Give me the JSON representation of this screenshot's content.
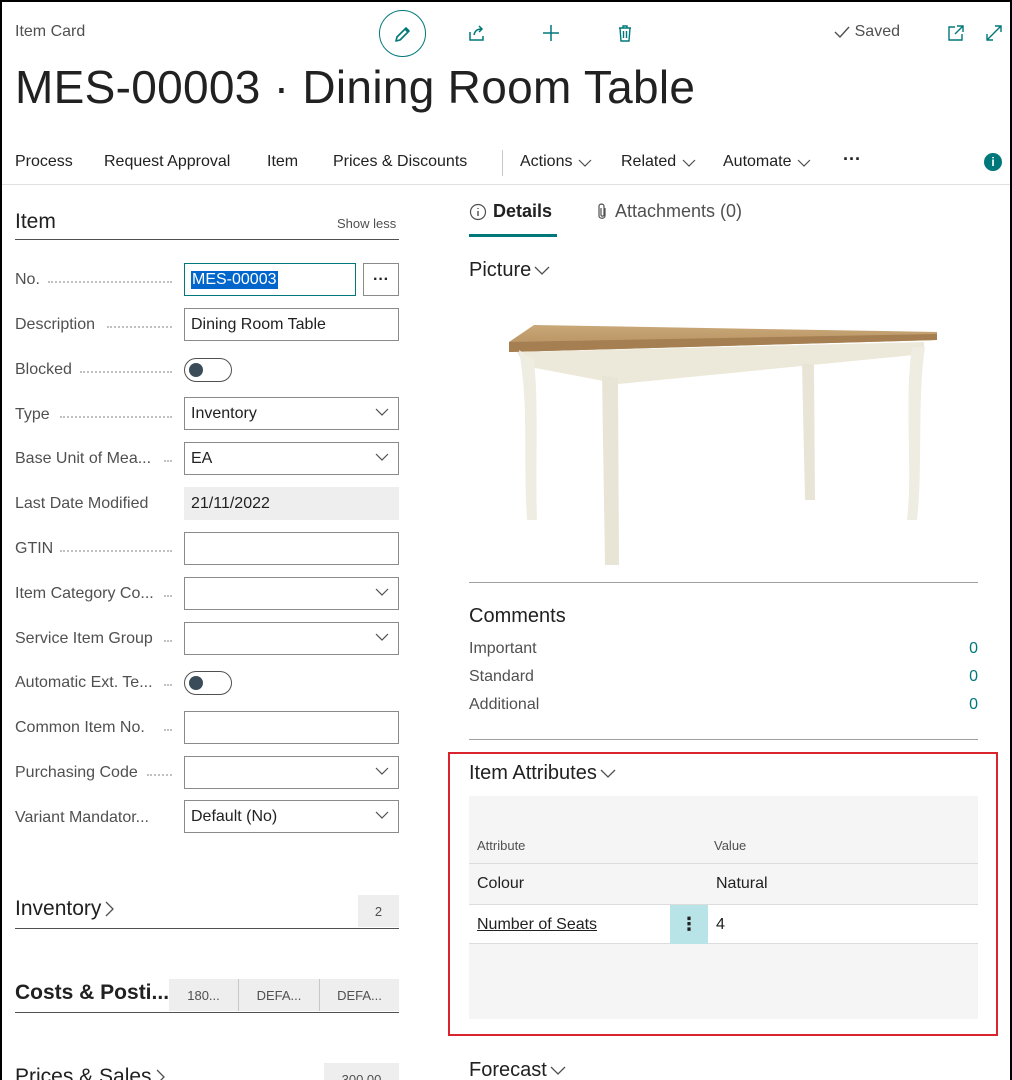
{
  "header": {
    "caption": "Item Card",
    "saved": "Saved",
    "title": "MES-00003 · Dining Room Table",
    "icons": [
      "pencil-icon",
      "share-icon",
      "plus-icon",
      "trash-icon",
      "check-icon",
      "open-new-window-icon",
      "expand-icon"
    ]
  },
  "actions": {
    "process": "Process",
    "request_approval": "Request Approval",
    "item": "Item",
    "prices_discounts": "Prices & Discounts",
    "actions": "Actions",
    "related": "Related",
    "automate": "Automate",
    "more": "···",
    "info": "i"
  },
  "item_section": {
    "title": "Item",
    "show_less": "Show less",
    "fields": {
      "no_label": "No.",
      "no_value": "MES-00003",
      "no_assist": "···",
      "description_label": "Description",
      "description_value": "Dining Room Table",
      "blocked_label": "Blocked",
      "blocked_on": false,
      "type_label": "Type",
      "type_value": "Inventory",
      "base_uom_label": "Base Unit of Mea...",
      "base_uom_value": "EA",
      "last_modified_label": "Last Date Modified",
      "last_modified_value": "21/11/2022",
      "gtin_label": "GTIN",
      "gtin_value": "",
      "item_category_label": "Item Category Co...",
      "item_category_value": "",
      "service_group_label": "Service Item Group",
      "service_group_value": "",
      "auto_ext_label": "Automatic Ext. Te...",
      "auto_ext_on": false,
      "common_item_label": "Common Item No.",
      "common_item_value": "",
      "purchasing_code_label": "Purchasing Code",
      "purchasing_code_value": "",
      "variant_label": "Variant Mandator...",
      "variant_value": "Default (No)"
    }
  },
  "fasttabs": {
    "inventory_title": "Inventory",
    "inventory_value": "2",
    "costs_title": "Costs & Posti...",
    "costs_v1": "180...",
    "costs_v2": "DEFA...",
    "costs_v3": "DEFA...",
    "prices_title": "Prices & Sales",
    "prices_value": "300.00"
  },
  "factbox": {
    "tab_details": "Details",
    "tab_attachments": "Attachments (0)",
    "picture_title": "Picture",
    "comments_title": "Comments",
    "comments": [
      {
        "label": "Important",
        "value": "0"
      },
      {
        "label": "Standard",
        "value": "0"
      },
      {
        "label": "Additional",
        "value": "0"
      }
    ],
    "attributes_title": "Item Attributes",
    "attr_col_attribute": "Attribute",
    "attr_col_value": "Value",
    "attributes": [
      {
        "attribute": "Colour",
        "value": "Natural"
      },
      {
        "attribute": "Number of Seats",
        "value": "4"
      }
    ],
    "forecast_title": "Forecast"
  },
  "colors": {
    "accent": "#00787a",
    "highlight_border": "#d9232d",
    "selection": "#0066cc"
  }
}
